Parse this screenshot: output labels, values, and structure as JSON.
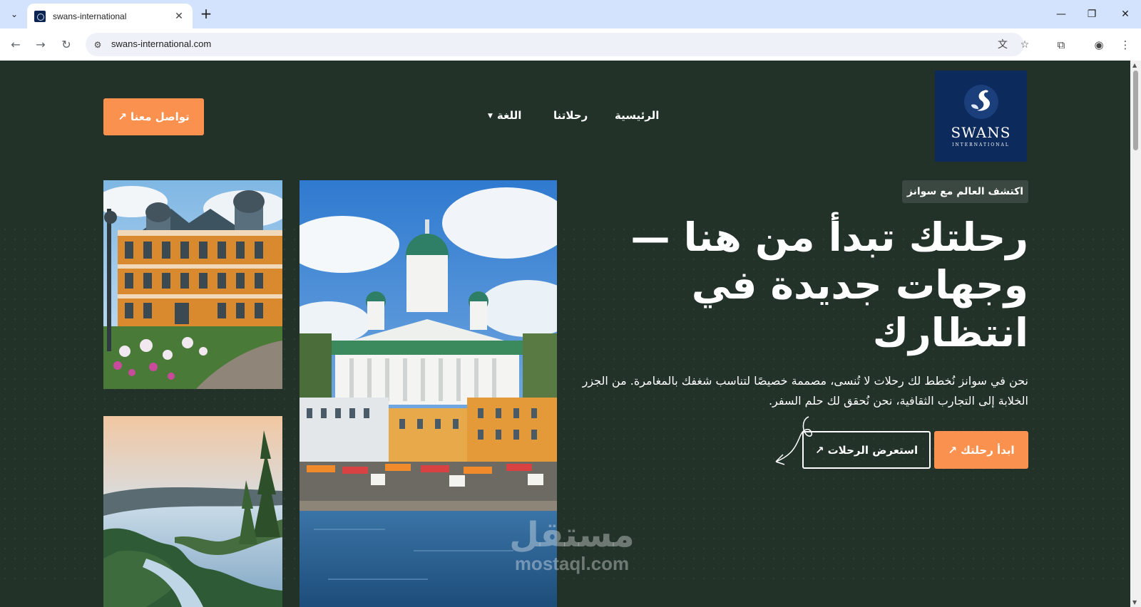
{
  "browser": {
    "tab_title": "swans-international",
    "url": "swans-international.com"
  },
  "brand": {
    "name": "SWANS",
    "subtitle": "INTERNATIONAL",
    "colors": {
      "background": "#223229",
      "accent": "#fb914e",
      "logo_bg": "#0c2a5b"
    }
  },
  "nav": {
    "home": "الرئيسية",
    "trips": "رحلاتنا",
    "language": "اللغة",
    "contact": "تواصل معنا ↗"
  },
  "hero": {
    "badge": "اكتشف العالم مع سوانز",
    "headline": "رحلتك تبدأ من هنا — وجهات جديدة في انتظارك",
    "description": "نحن في سوانز نُخطط لك رحلات لا تُنسى، مصممة خصيصًا لتناسب شغفك بالمغامرة. من الجزر الخلابة إلى التجارب الثقافية، نحن نُحقق لك حلم السفر.",
    "start_button": "ابدأ رحلتك ↗",
    "browse_button": "استعرض الرحلات ↗"
  },
  "watermark": {
    "arabic": "مستقل",
    "latin": "mostaql.com"
  },
  "icons": [
    "tab-list-icon",
    "close-icon",
    "plus-icon",
    "minimize-icon",
    "restore-icon",
    "back-icon",
    "forward-icon",
    "reload-icon",
    "site-info-icon",
    "translate-icon",
    "star-icon",
    "extensions-icon",
    "profile-icon",
    "menu-icon",
    "swan-icon",
    "caret-down-icon"
  ]
}
